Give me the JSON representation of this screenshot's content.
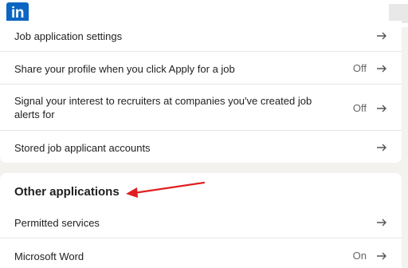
{
  "header": {
    "logo_text": "in",
    "brand_color": "#0a66c2"
  },
  "job_settings": {
    "rows": [
      {
        "label": "Job application settings",
        "status": "",
        "icon": "arrow-right-icon"
      },
      {
        "label": "Share your profile when you click Apply for a job",
        "status": "Off",
        "icon": "arrow-right-icon"
      },
      {
        "label": "Signal your interest to recruiters at companies you've created job alerts for",
        "status": "Off",
        "icon": "arrow-right-icon"
      },
      {
        "label": "Stored job applicant accounts",
        "status": "",
        "icon": "arrow-right-icon"
      }
    ]
  },
  "other_applications": {
    "title": "Other applications",
    "rows": [
      {
        "label": "Permitted services",
        "status": "",
        "icon": "arrow-right-icon"
      },
      {
        "label": "Microsoft Word",
        "status": "On",
        "icon": "arrow-right-icon"
      }
    ]
  },
  "annotation": {
    "arrow_color": "#e02020"
  }
}
